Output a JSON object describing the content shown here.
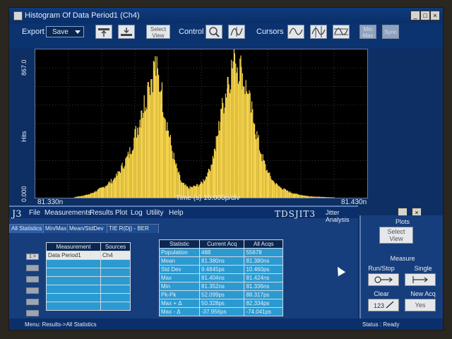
{
  "window": {
    "title": "Histogram Of Data Period1 (Ch4)"
  },
  "toolbar": {
    "export_label": "Export",
    "save_label": "Save",
    "select_view": [
      "Select",
      "View"
    ],
    "control_label": "Control",
    "cursors_label": "Cursors",
    "minmax": [
      "Min",
      "Max"
    ],
    "sync_label": "Sync"
  },
  "plot": {
    "ylabel": "Hits",
    "y_top": "867.0",
    "y_bottom": "0.000",
    "x_left": "81.330n",
    "x_right": "81.430n",
    "x_label": "Time (s)   10.000p/div"
  },
  "chart_data": {
    "type": "bar",
    "title": "Histogram Of Data Period1 (Ch4)",
    "ylabel": "Hits",
    "xlabel": "Time (s)",
    "xlim": [
      81.33,
      81.43
    ],
    "ylim": [
      0,
      867
    ],
    "grid": true,
    "series": [
      {
        "x": [
          81.342,
          81.346,
          81.35,
          81.354,
          81.358,
          81.362,
          81.364,
          81.366,
          81.368,
          81.37,
          81.372,
          81.374,
          81.376,
          81.378,
          81.38,
          81.382,
          81.384,
          81.386,
          81.388,
          81.39,
          81.392,
          81.394,
          81.396,
          81.398,
          81.4,
          81.402,
          81.404,
          81.406,
          81.408,
          81.412,
          81.416,
          81.42
        ],
        "y": [
          5,
          20,
          60,
          120,
          260,
          520,
          690,
          810,
          640,
          400,
          210,
          90,
          60,
          70,
          90,
          150,
          290,
          530,
          720,
          860,
          780,
          620,
          440,
          260,
          150,
          90,
          60,
          40,
          25,
          10,
          5,
          2
        ]
      }
    ]
  },
  "menubar": {
    "logo": "J3",
    "items": [
      "File",
      "Measurements",
      "Results",
      "Plot",
      "Log",
      "Utility",
      "Help"
    ],
    "brand": "TDSJIT3",
    "subtitle": "Jitter Analysis"
  },
  "tabs": [
    "All Statistics",
    "Min/Max",
    "Mean/StdDev",
    "TIE R(Dj) - BER"
  ],
  "sources": {
    "headers": [
      "Measurement",
      "Sources"
    ],
    "rows": [
      [
        "Data Period1",
        "Ch4"
      ],
      [
        "",
        ""
      ],
      [
        "",
        ""
      ],
      [
        "",
        ""
      ],
      [
        "",
        ""
      ],
      [
        "",
        ""
      ],
      [
        "",
        ""
      ]
    ]
  },
  "row_buttons": [
    "1 >"
  ],
  "stats": {
    "headers": [
      "Statistic",
      "Current Acq",
      "All Acqs"
    ],
    "rows": [
      [
        "Population",
        "488",
        "55678"
      ],
      [
        "Mean",
        "81.380ns",
        "81.380ns"
      ],
      [
        "Std Dev",
        "9.4845ps",
        "10.460ps"
      ],
      [
        "Max",
        "81.404ns",
        "81.424ns"
      ],
      [
        "Min",
        "81.352ns",
        "81.336ns"
      ],
      [
        "Pk-Pk",
        "52.099ps",
        "88.317ps"
      ],
      [
        "Max + Δ",
        "50.328ps",
        "82.334ps"
      ],
      [
        "Max - Δ",
        "-37.956ps",
        "-74.041ps"
      ]
    ]
  },
  "side": {
    "plots": "Plots",
    "select_view": [
      "Select",
      "View"
    ],
    "measure": "Measure",
    "runstop": "Run/Stop",
    "single": "Single",
    "clear": "Clear",
    "newacq": "New Acq",
    "yes": "Yes"
  },
  "status": {
    "menu": "Menu: Results->All Statistics",
    "state": "Status : Ready"
  },
  "colors": {
    "accent": "#f5d34a",
    "background": "#0d2f63"
  }
}
